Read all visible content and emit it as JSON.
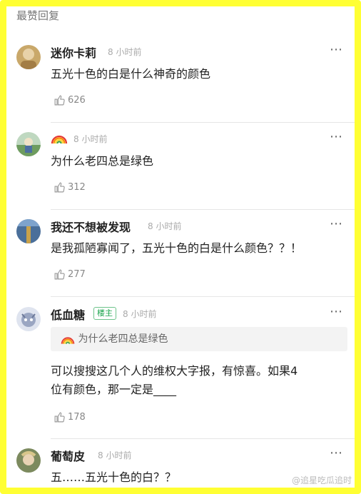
{
  "section": {
    "title": "最赞回复"
  },
  "comments": [
    {
      "name": "迷你卡莉",
      "time": "8 小时前",
      "text": "五光十色的白是什么神奇的颜色",
      "likes": "626",
      "avatar_color": "#c9a86a"
    },
    {
      "name_icon": "rainbow-icon",
      "time": "8 小时前",
      "text": "为什么老四总是绿色",
      "likes": "312",
      "avatar_color": "#7fb07a"
    },
    {
      "name": "我还不想被发现",
      "time": "8 小时前",
      "text": "是我孤陋寡闻了，五光十色的白是什么颜色？？！",
      "likes": "277",
      "avatar_color": "#4a6f9a"
    },
    {
      "name": "低血糖",
      "badge": "楼主",
      "time": "8 小时前",
      "quote": "为什么老四总是绿色",
      "text_lines": [
        "可以搜搜这几个人的维权大字报，有惊喜。如果4",
        "位有颜色，那一定是____"
      ],
      "likes": "178",
      "avatar_color": "#9aa6c2"
    },
    {
      "name": "葡萄皮",
      "time": "8 小时前",
      "text": "五……五光十色的白？？",
      "avatar_color": "#7c8a5e"
    }
  ],
  "more_icon": "⋯",
  "watermark": "@追星吃瓜追时"
}
